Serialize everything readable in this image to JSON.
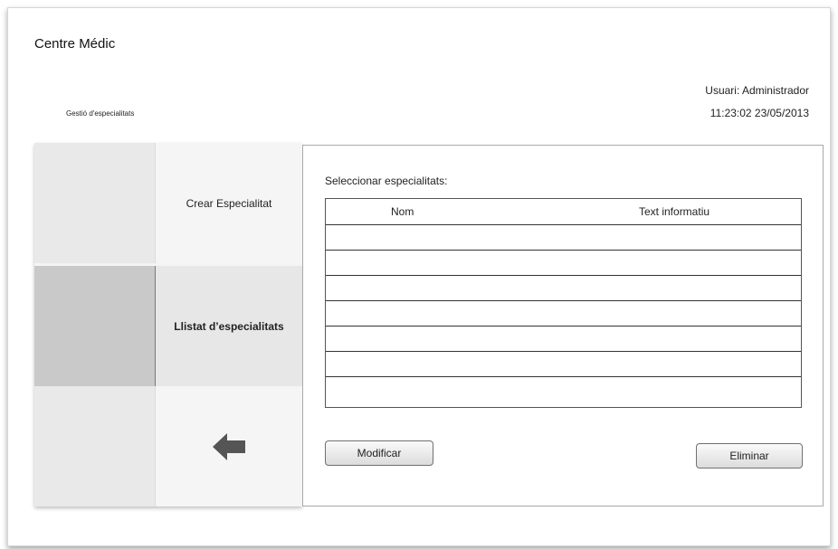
{
  "header": {
    "app_title": "Centre Médic",
    "section_title": "Gestió d'especialitats",
    "user": "Usuari: Administrador",
    "datetime": "11:23:02 23/05/2013"
  },
  "sidebar": {
    "items": [
      {
        "label": "Crear Especialitat",
        "active": false
      },
      {
        "label": "Llistat d’especialitats",
        "active": true
      }
    ],
    "back_icon": "arrow-left-icon"
  },
  "main": {
    "select_label": "Seleccionar especialitats:",
    "table": {
      "columns": [
        "Nom",
        "Text informatiu"
      ],
      "rows": [
        [
          "",
          ""
        ],
        [
          "",
          ""
        ],
        [
          "",
          ""
        ],
        [
          "",
          ""
        ],
        [
          "",
          ""
        ],
        [
          "",
          ""
        ],
        [
          "",
          ""
        ]
      ]
    },
    "buttons": {
      "modify": "Modificar",
      "delete": "Eliminar"
    }
  },
  "colors": {
    "active_stub": "#c9c9c9",
    "active_button": "#e7e7e7",
    "arrow": "#555555"
  }
}
